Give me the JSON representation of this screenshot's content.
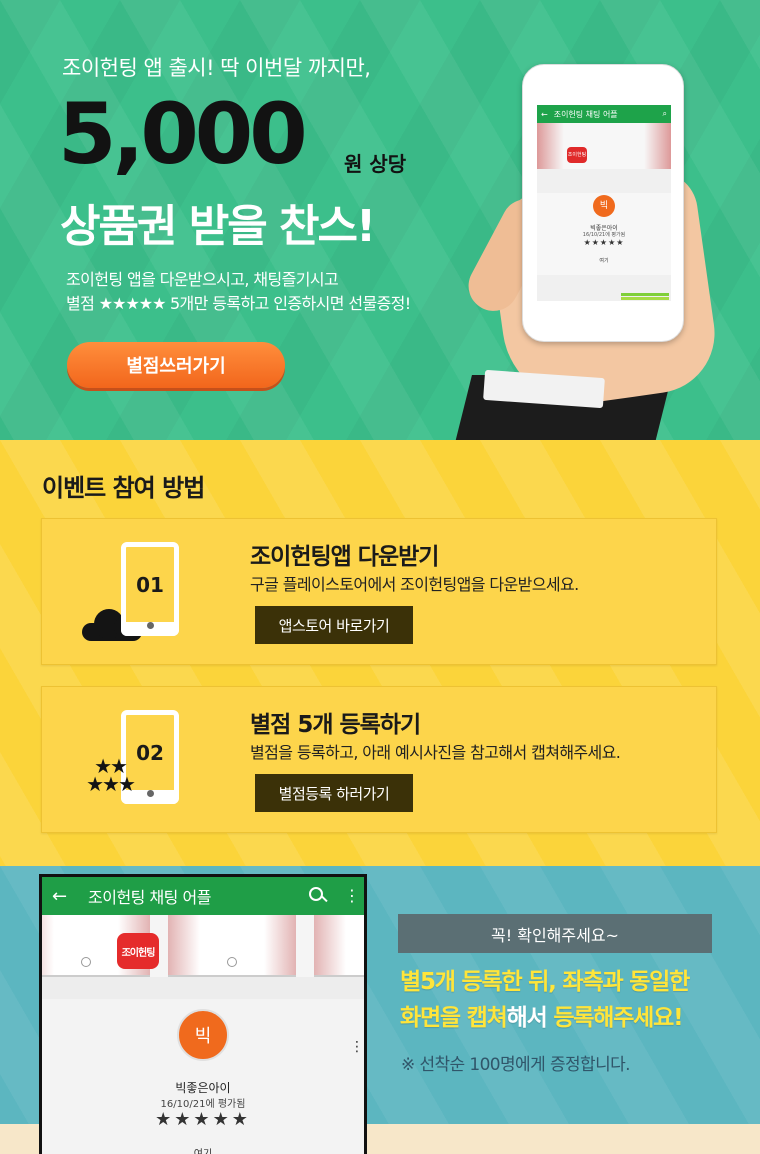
{
  "hero": {
    "subtitle": "조이헌팅 앱 출시! 딱 이번달 까지만,",
    "amount": "5,000",
    "unit": "원 상당",
    "headline": "상품권 받을 찬스!",
    "desc_line1": "조이헌팅 앱을 다운받으시고, 채팅즐기시고",
    "desc_line2_a": "별점",
    "desc_line2_stars": "★★★★★",
    "desc_line2_b": "5개만 등록하고 인증하시면 선물증정!",
    "cta_label": "별점쓰러가기",
    "phone": {
      "title": "조이헌팅 채팅 어플",
      "back": "←",
      "logo": "조이헌팅",
      "avatar": "빅",
      "name": "빅좋은아이",
      "date": "16/10/21에 평가됨",
      "stars": "★★★★★",
      "here": "여기"
    }
  },
  "howto": {
    "title": "이벤트 참여 방법",
    "steps": [
      {
        "num": "01",
        "title": "조이헌팅앱 다운받기",
        "desc": "구글 플레이스토어에서 조이헌팅앱을 다운받으세요.",
        "button": "앱스토어 바로가기"
      },
      {
        "num": "02",
        "title": "별점 5개 등록하기",
        "desc": "별점을 등록하고, 아래 예시사진을 참고해서 캡쳐해주세요.",
        "button": "별점등록 하러가기",
        "stars_top": "★★",
        "stars_bottom": "★★★"
      }
    ]
  },
  "capture": {
    "app_title": "조이헌팅 채팅 어플",
    "back": "←",
    "menu": "⋮",
    "logo": "조이헌팅",
    "avatar": "빅",
    "kebab": "⋮",
    "name": "빅좋은아이",
    "date": "16/10/21에 평가됨",
    "stars": "★★★★★",
    "here": "여기",
    "notice_label": "꼭! 확인해주세요~",
    "notice_y1": "별5개 등록한 뒤, 좌측과 동일한",
    "notice_y2": "화면을 캡쳐",
    "notice_w": "해서",
    "notice_y3": " 등록해주세요!",
    "notice_foot": "※ 선착순 100명에게 증정합니다."
  }
}
